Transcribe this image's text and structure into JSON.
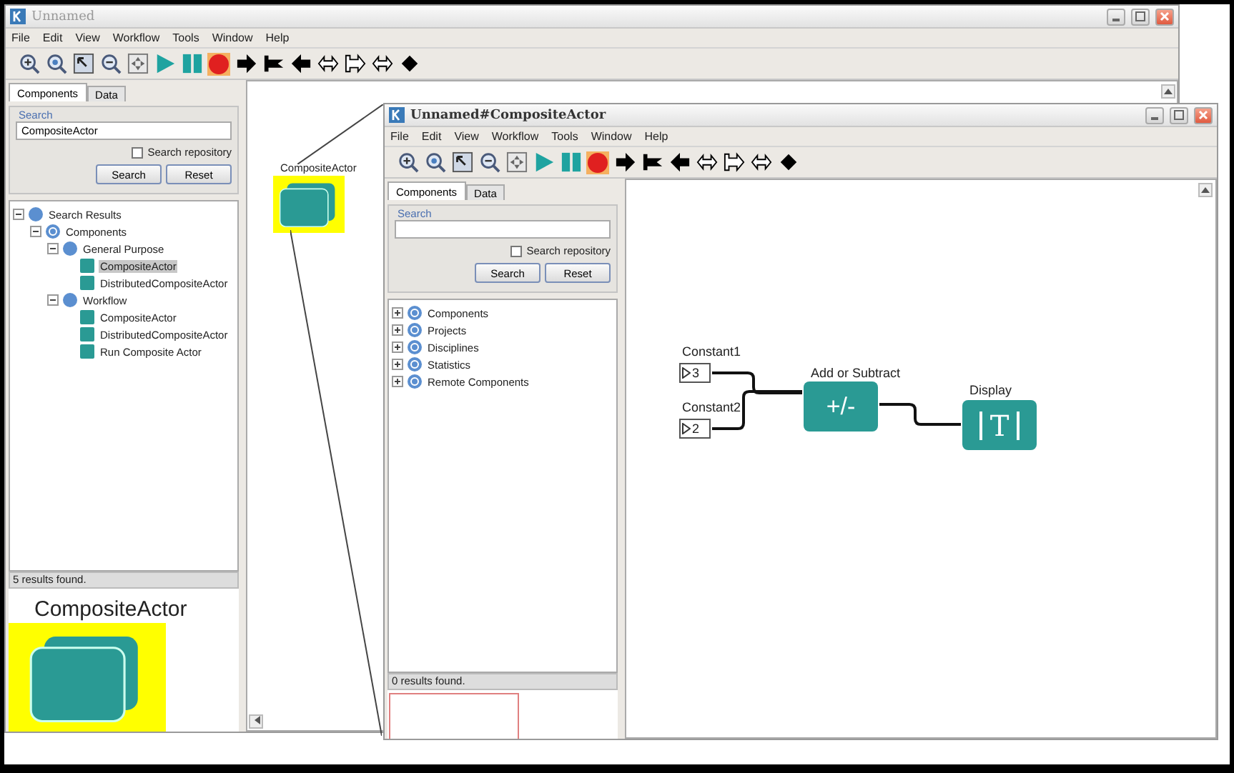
{
  "main_window": {
    "title": "Unnamed",
    "menu": [
      "File",
      "Edit",
      "View",
      "Workflow",
      "Tools",
      "Window",
      "Help"
    ],
    "library": {
      "tabs": [
        {
          "label": "Components",
          "selected": true
        },
        {
          "label": "Data",
          "selected": false
        }
      ],
      "search": {
        "legend": "Search",
        "value": "CompositeActor",
        "repository": {
          "label": "Search repository",
          "checked": false
        },
        "buttons": [
          "Search",
          "Reset"
        ]
      },
      "tree": [
        {
          "label": "Search Results",
          "kind": "root",
          "expanded": true,
          "selected": false,
          "children": [
            {
              "label": "Components",
              "kind": "folder",
              "expanded": true,
              "selected": false,
              "children": [
                {
                  "label": "General Purpose",
                  "kind": "category",
                  "expanded": true,
                  "selected": false,
                  "children": [
                    {
                      "label": "CompositeActor",
                      "kind": "actor",
                      "selected": true
                    },
                    {
                      "label": "DistributedCompositeActor",
                      "kind": "actor",
                      "selected": false
                    }
                  ]
                },
                {
                  "label": "Workflow",
                  "kind": "category",
                  "expanded": true,
                  "selected": false,
                  "children": [
                    {
                      "label": "CompositeActor",
                      "kind": "actor",
                      "selected": false
                    },
                    {
                      "label": "DistributedCompositeActor",
                      "kind": "actor",
                      "selected": false
                    },
                    {
                      "label": "Run Composite Actor",
                      "kind": "actor",
                      "selected": false
                    }
                  ]
                }
              ]
            }
          ]
        }
      ],
      "status": "5 results found."
    },
    "preview": {
      "label": "CompositeActor"
    },
    "canvas": {
      "actors": [
        {
          "kind": "composite",
          "label": "CompositeActor",
          "selected": true
        }
      ]
    }
  },
  "child_window": {
    "title": "Unnamed#CompositeActor",
    "menu": [
      "File",
      "Edit",
      "View",
      "Workflow",
      "Tools",
      "Window",
      "Help"
    ],
    "library": {
      "tabs": [
        {
          "label": "Components",
          "selected": true
        },
        {
          "label": "Data",
          "selected": false
        }
      ],
      "search": {
        "legend": "Search",
        "repository": {
          "label": "Search repository",
          "checked": false
        },
        "buttons": [
          "Search",
          "Reset"
        ]
      },
      "tree": [
        {
          "label": "Components",
          "kind": "folder",
          "expanded": false,
          "selected": false
        },
        {
          "label": "Projects",
          "kind": "folder",
          "expanded": false,
          "selected": false
        },
        {
          "label": "Disciplines",
          "kind": "folder",
          "expanded": false,
          "selected": false
        },
        {
          "label": "Statistics",
          "kind": "folder",
          "expanded": false,
          "selected": false
        },
        {
          "label": "Remote Components",
          "kind": "folder",
          "expanded": false,
          "selected": false
        }
      ],
      "status": "0 results found."
    },
    "canvas": {
      "actors": [
        {
          "kind": "constant",
          "label": "Constant1",
          "value": "3"
        },
        {
          "kind": "constant",
          "label": "Constant2",
          "value": "2"
        },
        {
          "kind": "add_subtract",
          "label": "Add or Subtract",
          "symbol": "+/-"
        },
        {
          "kind": "display",
          "label": "Display",
          "symbol": "T"
        }
      ]
    }
  }
}
